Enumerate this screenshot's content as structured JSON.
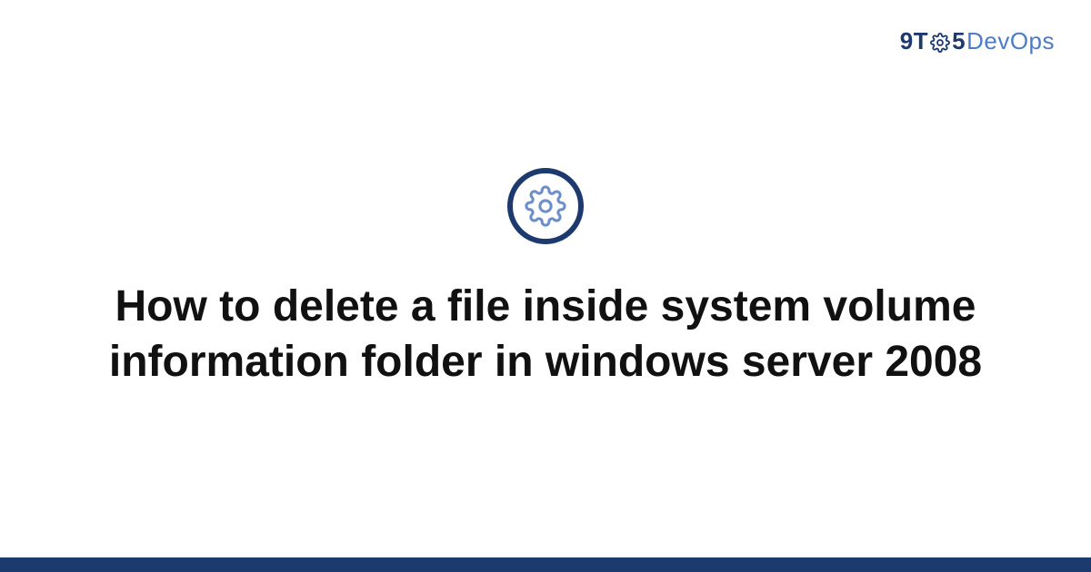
{
  "brand": {
    "part1": "9T",
    "part2": "5",
    "part3": "DevOps",
    "logo_icon_name": "gear-icon"
  },
  "hero": {
    "icon_name": "gear-icon"
  },
  "title": "How to delete a file inside system volume information folder in windows server 2008",
  "colors": {
    "brand_dark": "#1d3a6e",
    "brand_light": "#4d7cc7",
    "gear_stroke": "#6d8fc9"
  }
}
